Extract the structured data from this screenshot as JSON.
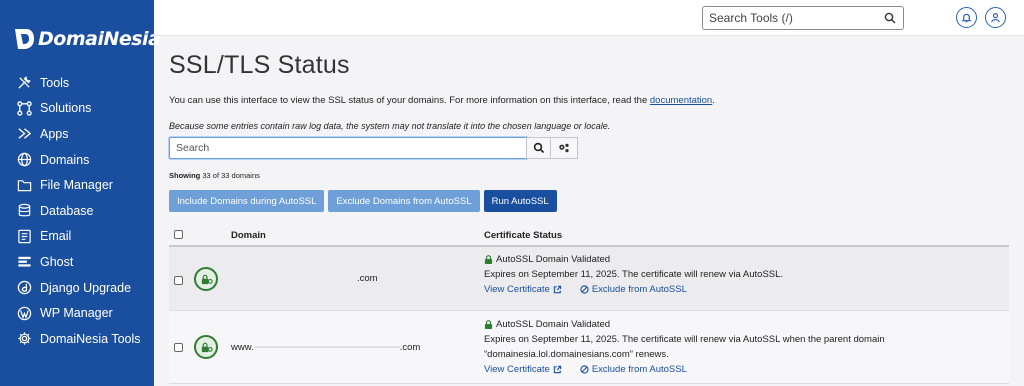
{
  "brand": {
    "name": "DomaiNesia"
  },
  "sidebar": {
    "items": [
      {
        "label": "Tools"
      },
      {
        "label": "Solutions"
      },
      {
        "label": "Apps"
      },
      {
        "label": "Domains"
      },
      {
        "label": "File Manager"
      },
      {
        "label": "Database"
      },
      {
        "label": "Email"
      },
      {
        "label": "Ghost"
      },
      {
        "label": "Django Upgrade"
      },
      {
        "label": "WP Manager"
      },
      {
        "label": "DomaiNesia Tools"
      }
    ]
  },
  "topbar": {
    "search_placeholder": "Search Tools (/)"
  },
  "page": {
    "title": "SSL/TLS Status",
    "intro_text": "You can use this interface to view the SSL status of your domains. For more information on this interface, read the ",
    "intro_link": "documentation",
    "intro_end": ".",
    "note": "Because some entries contain raw log data, the system may not translate it into the chosen language or locale.",
    "filter_placeholder": "Search",
    "showing_label": "Showing",
    "showing_count": "33 of 33 domains"
  },
  "actions": {
    "include": "Include Domains during AutoSSL",
    "exclude": "Exclude Domains from AutoSSL",
    "run": "Run AutoSSL"
  },
  "table": {
    "headers": {
      "domain": "Domain",
      "status": "Certificate Status"
    },
    "rows": [
      {
        "domain_prefix": "",
        "domain_suffix": ".com",
        "status": "AutoSSL Domain Validated",
        "expires_1": "Expires on September 11, 2025. The certificate will renew via AutoSSL.",
        "expires_2": "",
        "view": "View Certificate",
        "exclude": "Exclude from AutoSSL"
      },
      {
        "domain_prefix": "www.",
        "domain_suffix": ".com",
        "status": "AutoSSL Domain Validated",
        "expires_1": "Expires on September 11, 2025. The certificate will renew via AutoSSL when the parent domain",
        "expires_2": "“domainesia.lol.domainesians.com” renews.",
        "view": "View Certificate",
        "exclude": "Exclude from AutoSSL"
      }
    ]
  },
  "colors": {
    "sidebar": "#1a4fa0",
    "button": "#6e9fd8",
    "button_primary": "#1a4fa0",
    "link": "#1a4fa0",
    "valid": "#2e7d32"
  }
}
